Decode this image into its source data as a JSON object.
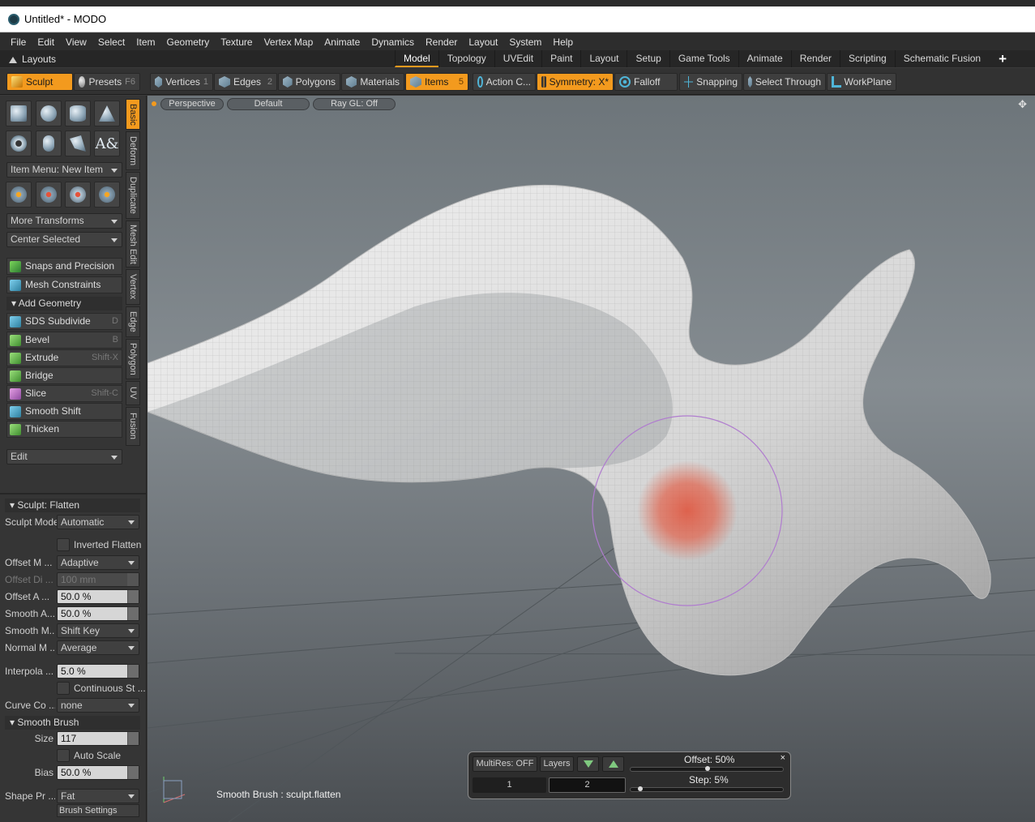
{
  "window": {
    "title": "Untitled* - MODO"
  },
  "menu": [
    "File",
    "Edit",
    "View",
    "Select",
    "Item",
    "Geometry",
    "Texture",
    "Vertex Map",
    "Animate",
    "Dynamics",
    "Render",
    "Layout",
    "System",
    "Help"
  ],
  "layouts": {
    "label": "Layouts",
    "tabs": [
      "Model",
      "Topology",
      "UVEdit",
      "Paint",
      "Layout",
      "Setup",
      "Game Tools",
      "Animate",
      "Render",
      "Scripting",
      "Schematic Fusion"
    ],
    "active": "Model",
    "add": "+"
  },
  "toolbar": {
    "sculpt": "Sculpt",
    "presets": "Presets",
    "presets_key": "F6",
    "vertices": "Vertices",
    "vertices_num": "1",
    "edges": "Edges",
    "edges_num": "2",
    "polygons": "Polygons",
    "materials": "Materials",
    "items": "Items",
    "items_num": "5",
    "action_center": "Action C...",
    "symmetry": "Symmetry: X*",
    "falloff": "Falloff",
    "snapping": "Snapping",
    "select_through": "Select Through",
    "workplane": "WorkPlane"
  },
  "vtabs": [
    "Basic",
    "Deform",
    "Duplicate",
    "Mesh Edit",
    "Vertex",
    "Edge",
    "Polygon",
    "UV",
    "Fusion"
  ],
  "left": {
    "item_menu": "Item Menu: New Item",
    "more_transforms": "More Transforms",
    "center_selected": "Center Selected",
    "snaps": "Snaps and Precision",
    "constraints": "Mesh Constraints",
    "add_geometry": "Add Geometry",
    "commands": [
      {
        "label": "SDS Subdivide",
        "key": "D"
      },
      {
        "label": "Bevel",
        "key": "B"
      },
      {
        "label": "Extrude",
        "key": "Shift-X"
      },
      {
        "label": "Bridge",
        "key": ""
      },
      {
        "label": "Slice",
        "key": "Shift-C"
      },
      {
        "label": "Smooth Shift",
        "key": ""
      },
      {
        "label": "Thicken",
        "key": ""
      }
    ],
    "edit": "Edit"
  },
  "props": {
    "header": "Sculpt: Flatten",
    "sculpt_mode_label": "Sculpt Mode",
    "sculpt_mode": "Automatic",
    "inverted_flatten": "Inverted Flatten",
    "offset_mode_label": "Offset M ...",
    "offset_mode": "Adaptive",
    "offset_dist_label": "Offset Di ...",
    "offset_dist": "100 mm",
    "offset_amt_label": "Offset A ...",
    "offset_amt": "50.0 %",
    "smooth_amt_label": "Smooth A...",
    "smooth_amt": "50.0 %",
    "smooth_mode_label": "Smooth M...",
    "smooth_mode": "Shift Key",
    "normal_mode_label": "Normal M ...",
    "normal_mode": "Average",
    "interp_label": "Interpola ...",
    "interp": "5.0 %",
    "continuous": "Continuous St ...",
    "curve_label": "Curve Co ...",
    "curve": "none",
    "smooth_brush": "Smooth Brush",
    "size_label": "Size",
    "size": "117",
    "auto_scale": "Auto Scale",
    "bias_label": "Bias",
    "bias": "50.0 %",
    "shape_label": "Shape Pr ...",
    "shape": "Fat",
    "brush_settings": "Brush Settings"
  },
  "viewport": {
    "view": "Perspective",
    "shading": "Default",
    "raygl": "Ray GL: Off",
    "status": "Smooth Brush : sculpt.flatten"
  },
  "hud": {
    "multires": "MultiRes: OFF",
    "layers": "Layers",
    "level1": "1",
    "level2": "2",
    "offset": "Offset:  50%",
    "offset_value": 0.5,
    "step": "Step:  5%",
    "step_value": 0.05
  }
}
